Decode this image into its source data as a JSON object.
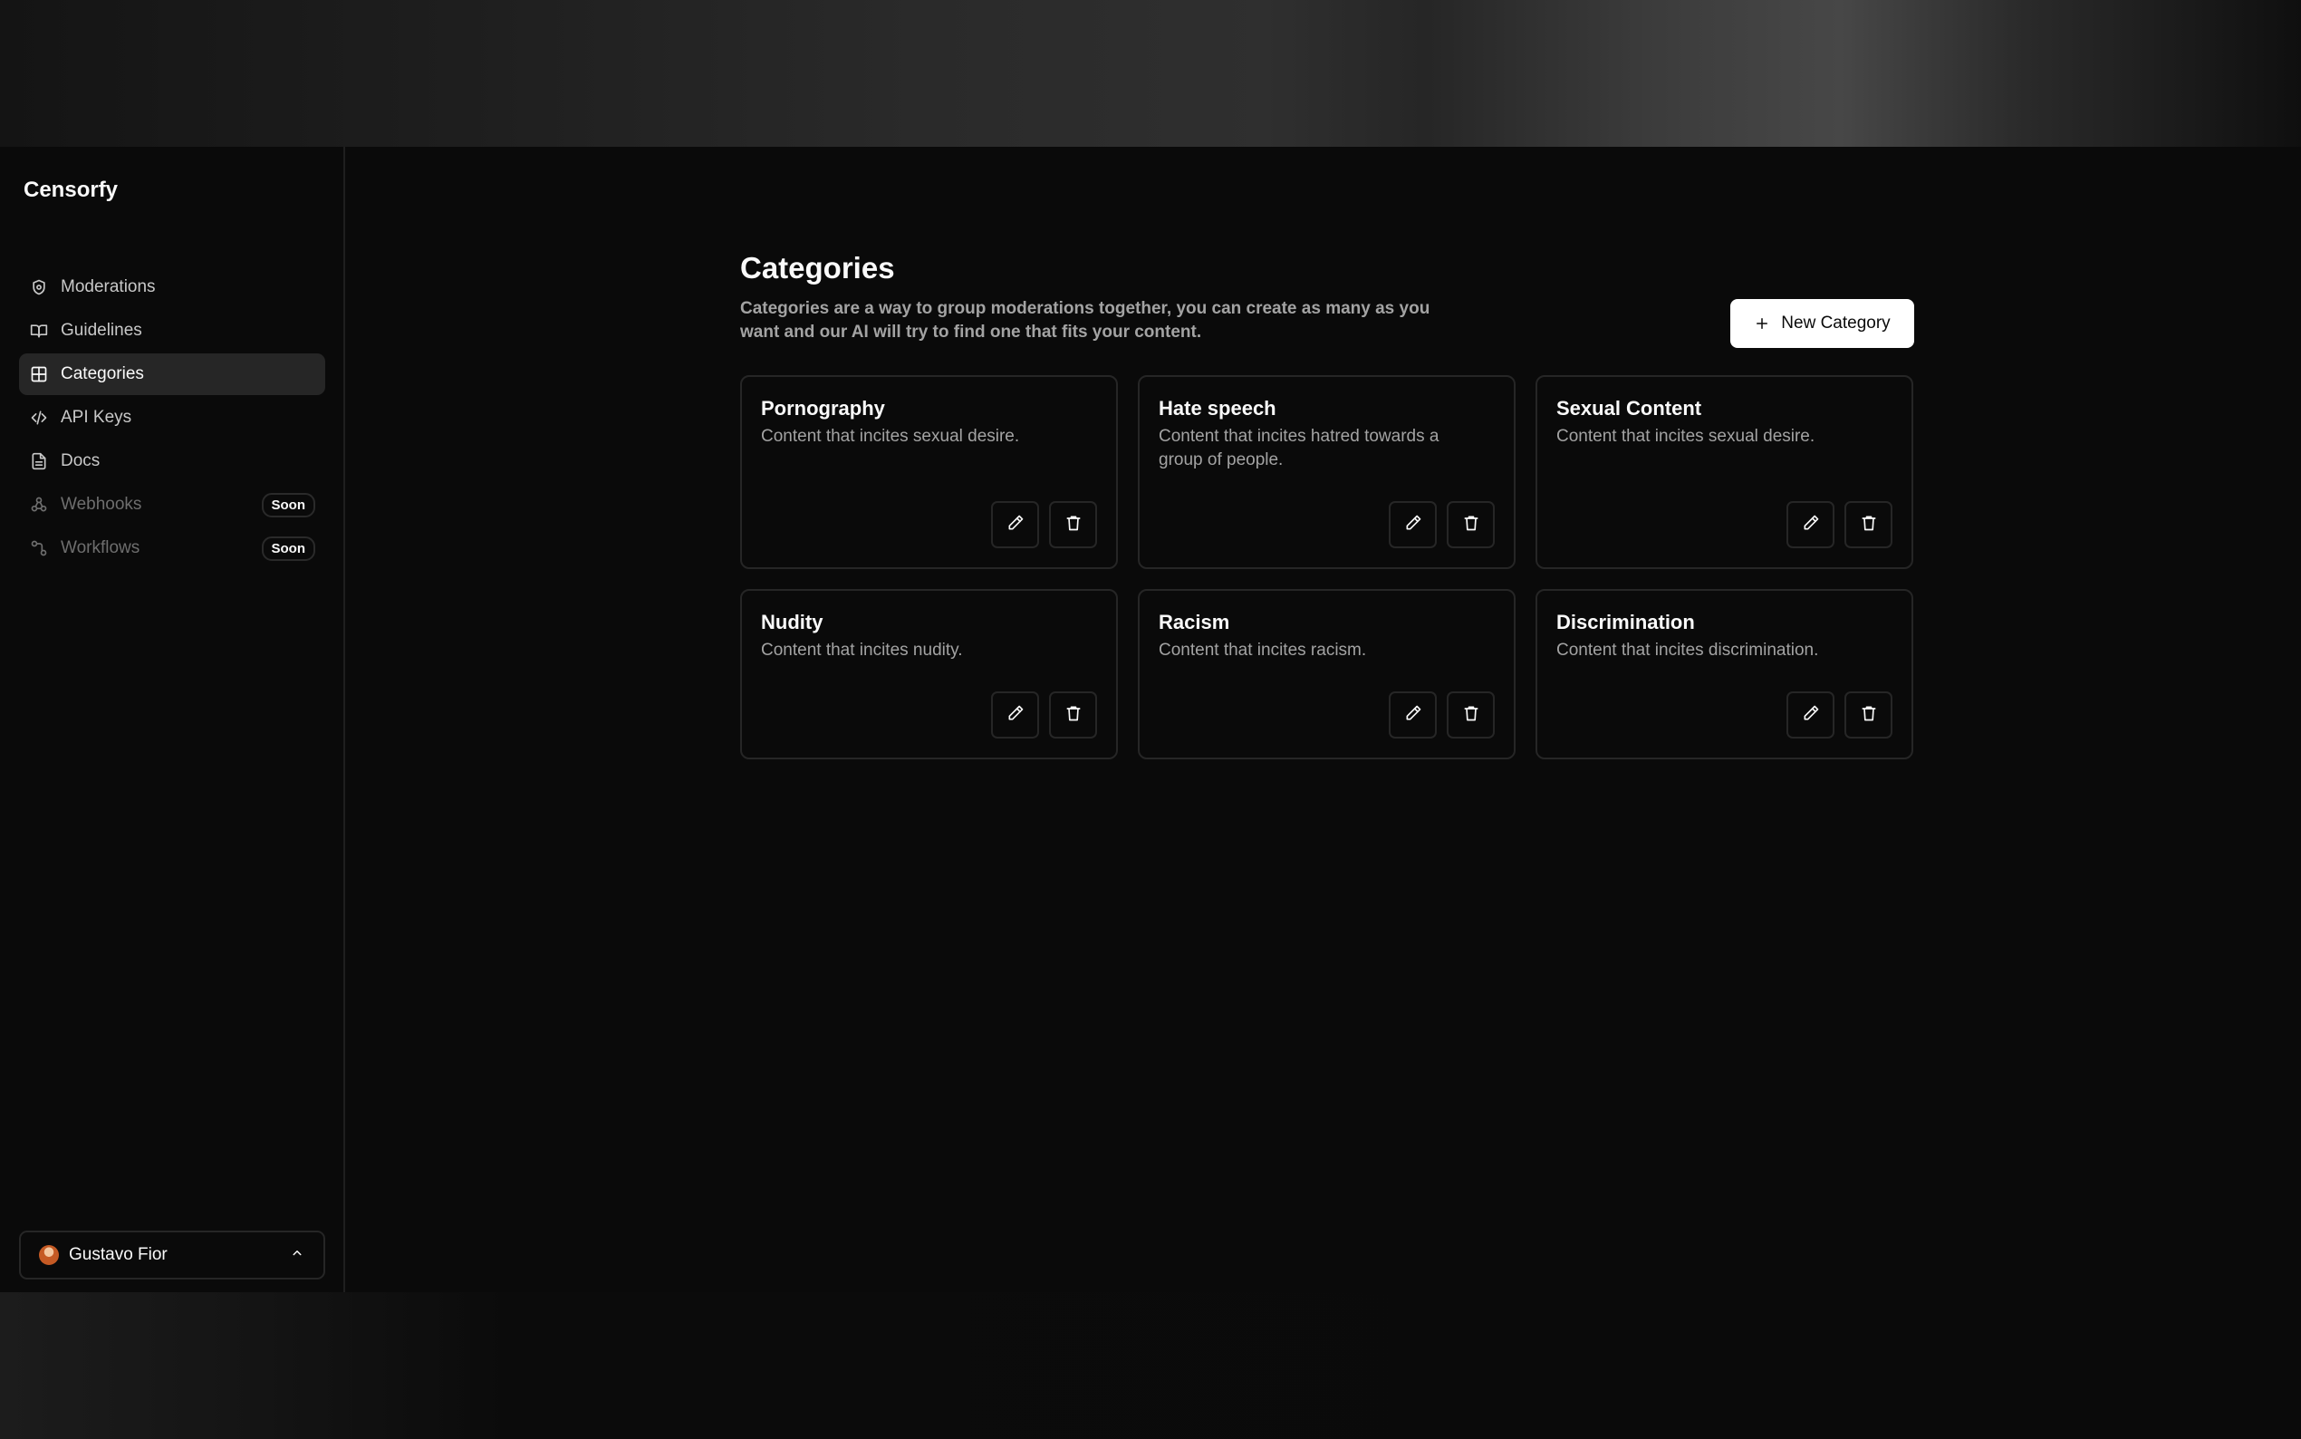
{
  "app": {
    "brand": "Censorfy"
  },
  "sidebar": {
    "items": [
      {
        "label": "Moderations",
        "icon": "shield-icon",
        "active": false,
        "disabled": false,
        "badge": ""
      },
      {
        "label": "Guidelines",
        "icon": "book-open-icon",
        "active": false,
        "disabled": false,
        "badge": ""
      },
      {
        "label": "Categories",
        "icon": "grid-icon",
        "active": true,
        "disabled": false,
        "badge": ""
      },
      {
        "label": "API Keys",
        "icon": "code-icon",
        "active": false,
        "disabled": false,
        "badge": ""
      },
      {
        "label": "Docs",
        "icon": "file-text-icon",
        "active": false,
        "disabled": false,
        "badge": ""
      },
      {
        "label": "Webhooks",
        "icon": "webhook-icon",
        "active": false,
        "disabled": true,
        "badge": "Soon"
      },
      {
        "label": "Workflows",
        "icon": "workflow-icon",
        "active": false,
        "disabled": true,
        "badge": "Soon"
      }
    ],
    "user": {
      "name": "Gustavo Fior",
      "menu_icon": "chevron-up-icon"
    }
  },
  "page": {
    "title": "Categories",
    "description": "Categories are a way to group moderations together, you can create as many as you want and our AI will try to find one that fits your content.",
    "new_button_label": "New Category"
  },
  "categories": [
    {
      "title": "Pornography",
      "description": "Content that incites sexual desire."
    },
    {
      "title": "Hate speech",
      "description": "Content that incites hatred towards a group of people."
    },
    {
      "title": "Sexual Content",
      "description": "Content that incites sexual desire."
    },
    {
      "title": "Nudity",
      "description": "Content that incites nudity."
    },
    {
      "title": "Racism",
      "description": "Content that incites racism."
    },
    {
      "title": "Discrimination",
      "description": "Content that incites discrimination."
    }
  ],
  "colors": {
    "background": "#0a0a0a",
    "active_nav": "#262626",
    "border": "#262626",
    "muted_text": "#a3a3a3",
    "primary_button": "#ffffff"
  }
}
